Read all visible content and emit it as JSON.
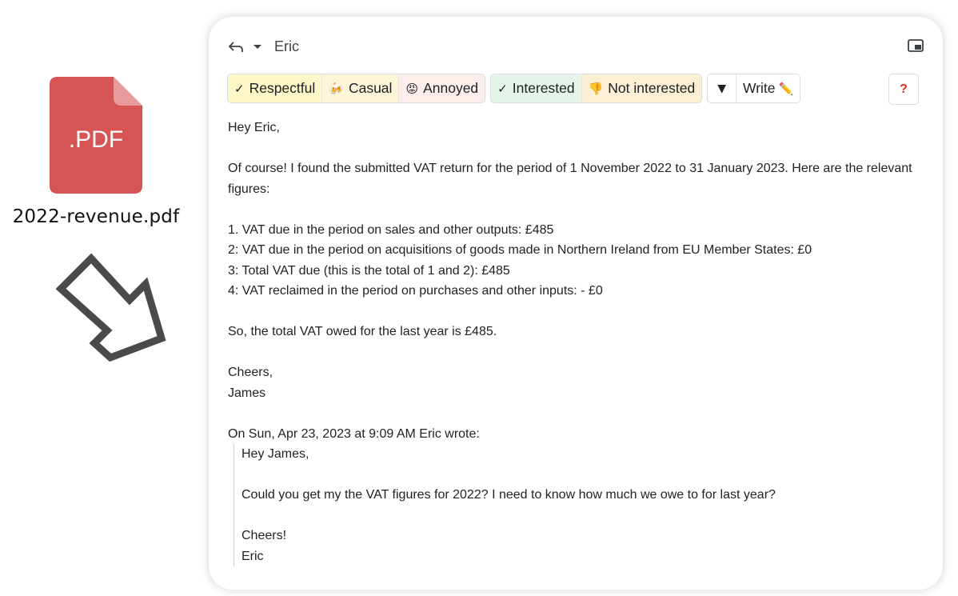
{
  "attachment": {
    "icon_label": ".PDF",
    "file_name": "2022-revenue.pdf",
    "icon_color": "#d65454"
  },
  "email": {
    "recipient": "Eric",
    "toolbar": {
      "tone_chips": [
        {
          "emoji": "✓",
          "label": "Respectful"
        },
        {
          "emoji": "🍻",
          "label": "Casual"
        },
        {
          "emoji": "😡",
          "label": "Annoyed"
        }
      ],
      "interest_chips": [
        {
          "emoji": "✓",
          "label": "Interested"
        },
        {
          "emoji": "👎",
          "label": "Not interested"
        }
      ],
      "dropdown_symbol": "▼",
      "write_label": "Write",
      "write_emoji": "✏️",
      "help_label": "?"
    },
    "body": {
      "greeting": "Hey Eric,",
      "intro": "Of course! I found the submitted VAT return for the period of 1 November 2022 to 31 January 2023. Here are the relevant figures:",
      "items": [
        "1. VAT due in the period on sales and other outputs: £485",
        "2: VAT due in the period on acquisitions of goods made in Northern Ireland from EU Member States: £0",
        "3: Total VAT due (this is the total of 1 and 2): £485",
        "4: VAT reclaimed in the period on purchases and other inputs: - £0"
      ],
      "summary": "So, the total VAT owed for the last year is £485.",
      "signoff": "Cheers,",
      "signature": "James"
    },
    "quoted": {
      "header": "On Sun, Apr 23, 2023 at 9:09 AM Eric wrote:",
      "greeting": "Hey James,",
      "message": "Could you get my the VAT figures for 2022? I need to know how much we owe to for last year?",
      "signoff": "Cheers!",
      "signature": "Eric"
    }
  }
}
